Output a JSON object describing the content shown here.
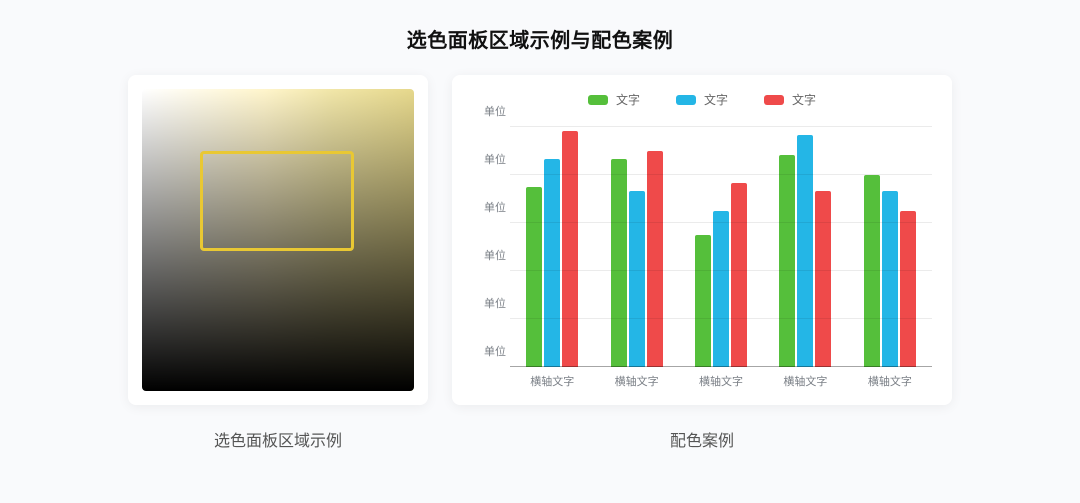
{
  "page_title": "选色面板区域示例与配色案例",
  "left_caption": "选色面板区域示例",
  "right_caption": "配色案例",
  "colors": {
    "series": [
      "#55bf3b",
      "#24b6e6",
      "#ef4a4a"
    ],
    "grid": "rgba(0,0,0,0.08)",
    "picker_highlight": "#e9c833"
  },
  "chart_data": {
    "type": "bar",
    "categories": [
      "横轴文字",
      "横轴文字",
      "横轴文字",
      "横轴文字",
      "横轴文字"
    ],
    "series": [
      {
        "name": "文字",
        "values": [
          4.5,
          5.2,
          3.3,
          5.3,
          4.8
        ]
      },
      {
        "name": "文字",
        "values": [
          5.2,
          4.4,
          3.9,
          5.8,
          4.4
        ]
      },
      {
        "name": "文字",
        "values": [
          5.9,
          5.4,
          4.6,
          4.4,
          3.9
        ]
      }
    ],
    "ylabel": "单位",
    "xlabel": "",
    "ylim": [
      0,
      6
    ],
    "y_ticks": [
      "单位",
      "单位",
      "单位",
      "单位",
      "单位",
      "单位"
    ],
    "legend_position": "top"
  }
}
